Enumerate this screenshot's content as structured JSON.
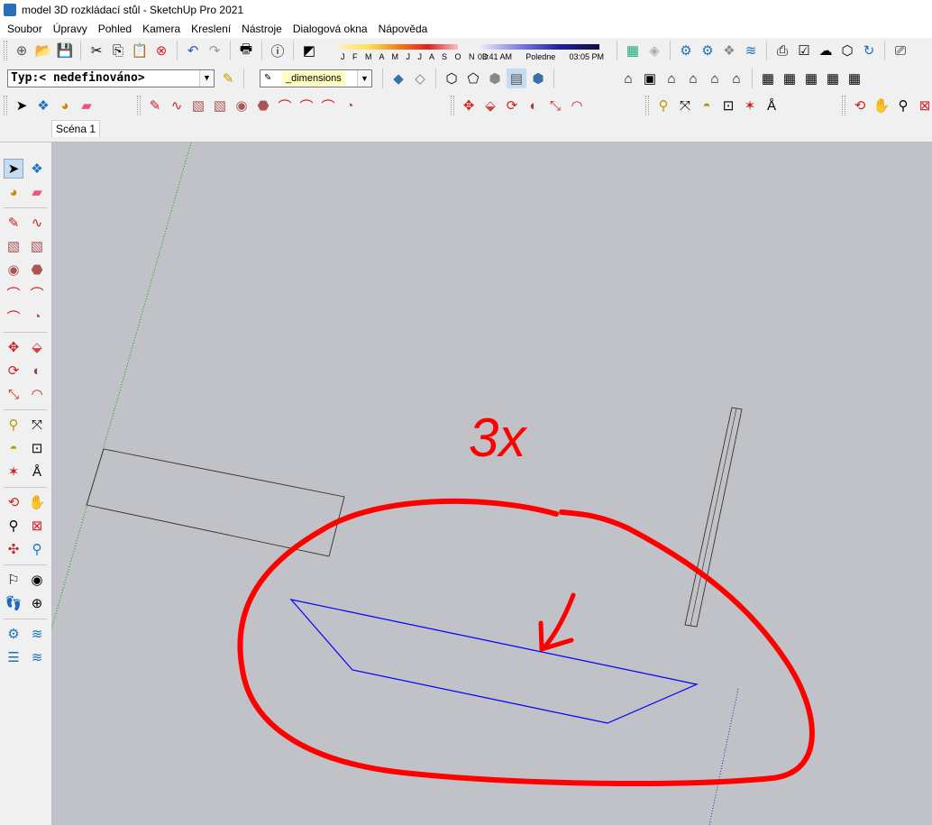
{
  "window": {
    "title": "model 3D rozkládací stůl - SketchUp Pro 2021"
  },
  "menu": [
    "Soubor",
    "Úpravy",
    "Pohled",
    "Kamera",
    "Kreslení",
    "Nástroje",
    "Dialogová okna",
    "Nápověda"
  ],
  "shadows": {
    "months": "J F M A M J J A S O N D",
    "time_start": "03:41 AM",
    "time_mid": "Poledne",
    "time_end": "03:05 PM"
  },
  "entity_info": {
    "type_value": "Typ:< nedefinováno>"
  },
  "tag_select": {
    "value": "_dimensions"
  },
  "scene_tabs": [
    "Scéna 1"
  ],
  "annotation": {
    "text": "3x",
    "color": "#ff0000"
  },
  "colors": {
    "canvas_bg": "#c1c2c7",
    "selection_blue": "#0000ff",
    "green_axis": "#00aa00",
    "markup_red": "#ff0000"
  }
}
